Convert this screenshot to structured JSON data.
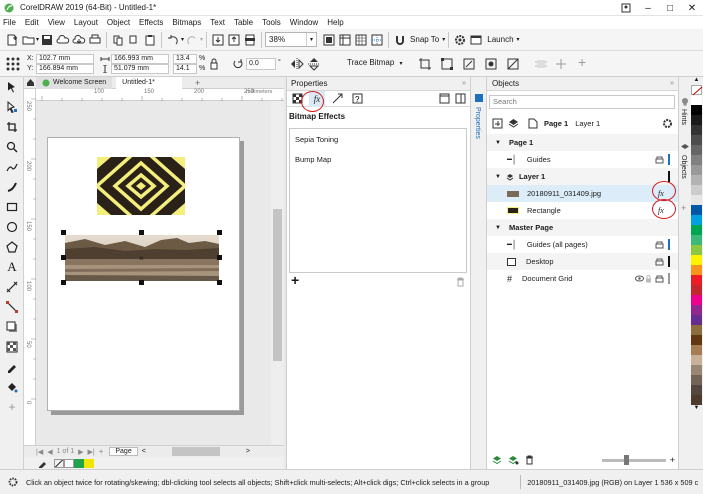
{
  "window": {
    "title": "CorelDRAW 2019 (64-Bit) - Untitled-1*",
    "controls": [
      "minimize-icon",
      "maximize-icon",
      "close-icon"
    ]
  },
  "menu": [
    "File",
    "Edit",
    "View",
    "Layout",
    "Object",
    "Effects",
    "Bitmaps",
    "Text",
    "Table",
    "Tools",
    "Window",
    "Help"
  ],
  "standard_toolbar": {
    "zoom": "38%",
    "snap_to": "Snap To",
    "launch": "Launch"
  },
  "property_bar": {
    "x": "102.7 mm",
    "y": "166.894 mm",
    "width": "166.993 mm",
    "height": "51.079 mm",
    "scale_w": "13.4",
    "scale_h": "14.1",
    "scale_unit": "%",
    "rotation": "0.0",
    "rotation_unit": "°",
    "trace_bitmap": "Trace Bitmap",
    "x_label": "X:",
    "y_label": "Y:"
  },
  "doc_tabs": {
    "welcome": "Welcome Screen",
    "active": "Untitled-1*"
  },
  "ruler": {
    "units": "millimeters",
    "h_ticks": [
      "100",
      "150",
      "200",
      "250"
    ],
    "v_ticks": [
      "250",
      "200",
      "150",
      "100",
      "50",
      "0"
    ]
  },
  "page_nav": {
    "label": "1 of 1",
    "page_tab": "Page"
  },
  "properties": {
    "header": "Properties",
    "section": "Bitmap Effects",
    "effects": [
      "Sepia Toning",
      "Bump Map"
    ],
    "add": "+"
  },
  "side_tabs": {
    "properties": "Properties",
    "objects": "Objects",
    "hints": "Hints"
  },
  "objects": {
    "header": "Objects",
    "search_placeholder": "Search",
    "page_label": "Page 1",
    "layer_label": "Layer 1",
    "tree": [
      {
        "label": "Page 1",
        "type": "group"
      },
      {
        "label": "Guides",
        "type": "item"
      },
      {
        "label": "Layer 1",
        "type": "group"
      },
      {
        "label": "20180911_031409.jpg",
        "type": "item",
        "fx": true
      },
      {
        "label": "Rectangle",
        "type": "item",
        "fx": true
      },
      {
        "label": "Master Page",
        "type": "group"
      },
      {
        "label": "Guides (all pages)",
        "type": "item"
      },
      {
        "label": "Desktop",
        "type": "item"
      },
      {
        "label": "Document Grid",
        "type": "item"
      }
    ],
    "fx_label": "fx"
  },
  "status": {
    "hint": "Click an object twice for rotating/skewing; dbl-clicking tool selects all objects; Shift+click multi-selects; Alt+click digs; Ctrl+click selects in a group",
    "right": "20180911_031409.jpg (RGB) on Layer 1 536 x 509 c"
  },
  "colors": {
    "accent": "#1e6fbf",
    "highlight_ring": "#d21b1b",
    "page_bg": "#ffffff",
    "canvas_bg": "#e9e9e9"
  },
  "palette": [
    "#ffffff",
    "#000000",
    "#1a1a1a",
    "#333333",
    "#4d4d4d",
    "#666666",
    "#808080",
    "#999999",
    "#b3b3b3",
    "#cccccc",
    "#e6e6e6",
    "#0057a8",
    "#00a0e3",
    "#00a651",
    "#3cb878",
    "#8dc63f",
    "#fff200",
    "#f7941d",
    "#ed1c24",
    "#c1272d",
    "#ec008c",
    "#92278f",
    "#662d91",
    "#8b6d3e",
    "#603913",
    "#a67c52",
    "#c7b299",
    "#998675",
    "#736357",
    "#534741",
    "#4d3b2d"
  ]
}
